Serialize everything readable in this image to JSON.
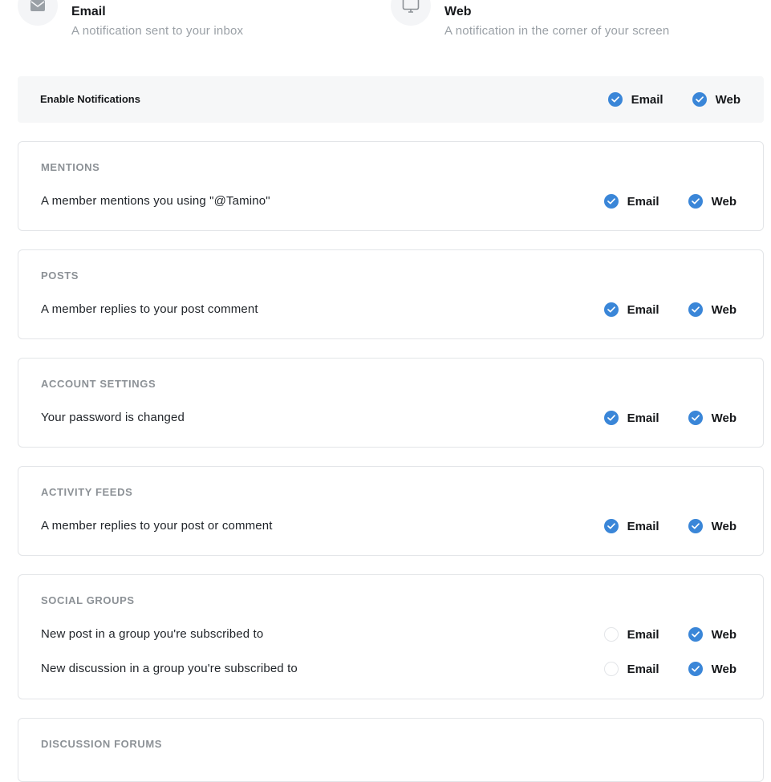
{
  "legend": {
    "email": {
      "title": "Email",
      "description": "A notification sent to your inbox",
      "icon": "envelope-icon"
    },
    "web": {
      "title": "Web",
      "description": "A notification in the corner of your screen",
      "icon": "monitor-icon"
    }
  },
  "enable": {
    "label": "Enable Notifications",
    "email_label": "Email",
    "email_checked": true,
    "web_label": "Web",
    "web_checked": true
  },
  "sections": [
    {
      "heading": "MENTIONS",
      "rows": [
        {
          "text": "A member mentions you using \"@Tamino\"",
          "email_label": "Email",
          "email_checked": true,
          "web_label": "Web",
          "web_checked": true
        }
      ]
    },
    {
      "heading": "POSTS",
      "rows": [
        {
          "text": "A member replies to your post comment",
          "email_label": "Email",
          "email_checked": true,
          "web_label": "Web",
          "web_checked": true
        }
      ]
    },
    {
      "heading": "ACCOUNT SETTINGS",
      "rows": [
        {
          "text": "Your password is changed",
          "email_label": "Email",
          "email_checked": true,
          "web_label": "Web",
          "web_checked": true
        }
      ]
    },
    {
      "heading": "ACTIVITY FEEDS",
      "rows": [
        {
          "text": "A member replies to your post or comment",
          "email_label": "Email",
          "email_checked": true,
          "web_label": "Web",
          "web_checked": true
        }
      ]
    },
    {
      "heading": "SOCIAL GROUPS",
      "rows": [
        {
          "text": "New post in a group you're subscribed to",
          "email_label": "Email",
          "email_checked": false,
          "web_label": "Web",
          "web_checked": true
        },
        {
          "text": "New discussion in a group you're subscribed to",
          "email_label": "Email",
          "email_checked": false,
          "web_label": "Web",
          "web_checked": true
        }
      ]
    },
    {
      "heading": "DISCUSSION FORUMS",
      "rows": []
    }
  ],
  "colors": {
    "accent": "#3a86d8",
    "border": "#e3e5e8",
    "muted": "#8c9196"
  }
}
